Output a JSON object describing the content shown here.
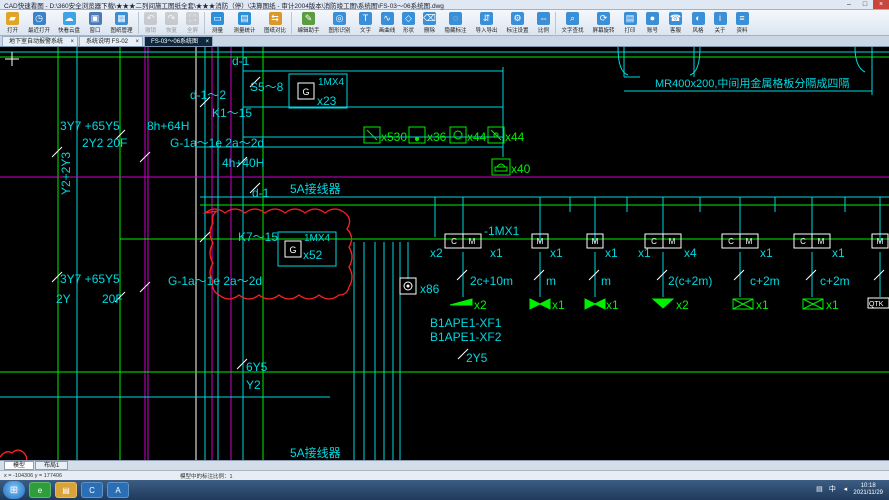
{
  "window": {
    "title": "CAD快速看图 - D:\\360安全浏览器下载\\★★★二列间施工图纸全套\\★★★消防（停）\\决算图纸 - 审计2004版本\\消防竣工图\\系统图\\FS-03～06系统图.dwg"
  },
  "toolbar": {
    "items": [
      {
        "label": "打开",
        "icon": "folder-open-icon",
        "color": "#e0a526"
      },
      {
        "label": "最近打开",
        "icon": "clock-icon",
        "color": "#3c82c8"
      },
      {
        "label": "快看云盘",
        "icon": "cloud-icon",
        "color": "#3fa3e6"
      },
      {
        "label": "窗口",
        "icon": "window-icon",
        "color": "#4a7bb8"
      },
      {
        "label": "图纸管理",
        "icon": "drawings-icon",
        "color": "#3a8fd6"
      },
      {
        "label": "撤销",
        "icon": "undo-icon",
        "color": "#888888",
        "disabled": true
      },
      {
        "label": "恢复",
        "icon": "redo-icon",
        "color": "#888888",
        "disabled": true
      },
      {
        "label": "全屏",
        "icon": "fullscreen-icon",
        "color": "#888888",
        "disabled": true
      },
      {
        "label": "测量",
        "icon": "measure-icon",
        "color": "#2f8ed8"
      },
      {
        "label": "测量统计",
        "icon": "measure-stats-icon",
        "color": "#2f8ed8"
      },
      {
        "label": "图纸对比",
        "icon": "compare-icon",
        "color": "#d9982a"
      },
      {
        "label": "编辑助手",
        "icon": "edit-assistant-icon",
        "color": "#5b9c3e"
      },
      {
        "label": "图形识别",
        "icon": "recognize-icon",
        "color": "#3a8fd6"
      },
      {
        "label": "文字",
        "icon": "text-icon",
        "color": "#3a8fd6"
      },
      {
        "label": "画曲线",
        "icon": "curve-icon",
        "color": "#3a8fd6"
      },
      {
        "label": "形状",
        "icon": "shape-icon",
        "color": "#3a8fd6"
      },
      {
        "label": "删除",
        "icon": "eraser-icon",
        "color": "#3a8fd6"
      },
      {
        "label": "隐藏标注",
        "icon": "hide-annotation-icon",
        "color": "#3a8fd6"
      },
      {
        "label": "导入导出",
        "icon": "import-export-icon",
        "color": "#3a8fd6"
      },
      {
        "label": "标注设置",
        "icon": "settings-icon",
        "color": "#3a8fd6"
      },
      {
        "label": "比例",
        "icon": "scale-icon",
        "color": "#3a8fd6"
      },
      {
        "label": "文字查找",
        "icon": "find-text-icon",
        "color": "#3a8fd6"
      },
      {
        "label": "屏幕旋转",
        "icon": "rotate-icon",
        "color": "#3a8fd6"
      },
      {
        "label": "打印",
        "icon": "print-icon",
        "color": "#3a8fd6"
      },
      {
        "label": "账号",
        "icon": "account-icon",
        "color": "#3a8fd6"
      },
      {
        "label": "客服",
        "icon": "support-icon",
        "color": "#3a8fd6"
      },
      {
        "label": "风格",
        "icon": "theme-icon",
        "color": "#3a8fd6"
      },
      {
        "label": "关于",
        "icon": "about-icon",
        "color": "#3a8fd6"
      },
      {
        "label": "资料",
        "icon": "docs-icon",
        "color": "#3a8fd6"
      }
    ]
  },
  "tabs": [
    {
      "label": "地下室自动报警系统",
      "active": false
    },
    {
      "label": "系统说明 FS-02",
      "active": false
    },
    {
      "label": "FS-03～06系统图",
      "active": true
    }
  ],
  "drawing": {
    "colors": {
      "yellow": "#f0f000",
      "cyan": "#00d8e0",
      "green": "#00f000",
      "magenta": "#d000d0",
      "red": "#ff2020",
      "white": "#ffffff"
    },
    "cursor": "+",
    "labels": {
      "d1_top": "d-1",
      "s5_8": "S5～8",
      "d1_2": "d-1～2",
      "k1_15": "K1～15",
      "l3y7": "3Y7 +65Y5",
      "l8h64h": "8h+64H",
      "l2y2": "2Y2 20F",
      "g1a2d_top": "G-1a～1e 2a～2d",
      "l4h40h": "4h+40H",
      "d1_mid": "d-1",
      "v2y3": "Y2+2Y3",
      "module_g_top": "1MX4",
      "module_x23": "x23",
      "sym_x530": "x530",
      "sym_x36": "x36",
      "sym_x44a": "x44",
      "sym_x44b": "x44",
      "sym_x40": "x40",
      "junction_top": "5A接线器",
      "k7_15": "K7～15",
      "module_g_bot": "1MX4",
      "module_x52": "x52",
      "l3y7b": "3Y7 +65Y5",
      "l2y": "2Y",
      "l20f": "20F",
      "g1a2d_bot": "G-1a～1e 2a～2d",
      "sym_x86": "x86",
      "c1mx1": "-1MX1",
      "x2a": "x2",
      "x1a": "x1",
      "x1b": "x1",
      "x1c": "x1",
      "x4a": "x4",
      "x1d": "x1",
      "x1e": "x1",
      "x1f": "x1",
      "c2c10m": "2c+10m",
      "c_m1": "m",
      "c_m2": "m",
      "c2c2m": "2(c+2m)",
      "c_c2m_a": "c+2m",
      "c_c2m_b": "c+2m",
      "x2b": "x2",
      "x1g": "x1",
      "x1h": "x1",
      "x2c": "x2",
      "x1i": "x1",
      "x1j": "x1",
      "b1ape_xf1": "B1APE1-XF1",
      "b1ape_xf2": "B1APE1-XF2",
      "l2y5": "2Y5",
      "l6y5": "6Y5",
      "ly2": "Y2",
      "junction_bot": "5A接线器",
      "mr400": "MR400x200,中间用金属格板分隔成四隔",
      "qtk": "QTK"
    }
  },
  "layout_tabs": [
    {
      "label": "模型",
      "active": true
    },
    {
      "label": "布局1",
      "active": false
    }
  ],
  "status": {
    "coords": "x = -104306 y = 177406",
    "scale": "模型中的标注比例：1"
  },
  "taskbar": {
    "apps": [
      {
        "icon": "browser-360-icon",
        "glyph": "e"
      },
      {
        "icon": "file-explorer-icon",
        "glyph": "▤"
      },
      {
        "icon": "cad-viewer-icon",
        "glyph": "C"
      },
      {
        "icon": "cad-app-icon",
        "glyph": "A"
      }
    ],
    "ime": "中",
    "time": "10:18",
    "date": "2021/11/29"
  }
}
